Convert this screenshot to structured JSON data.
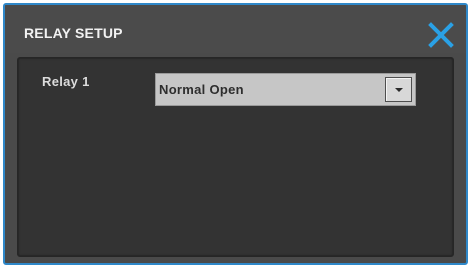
{
  "window": {
    "title": "RELAY SETUP",
    "close_icon": "close-icon"
  },
  "relay": {
    "label": "Relay 1",
    "selected_value": "Normal Open",
    "dropdown_icon": "chevron-down-icon"
  },
  "colors": {
    "accent": "#2f88c9",
    "close_icon": "#2aa1e6",
    "dialog_bg": "#4a4a4a",
    "panel_bg": "#333333",
    "select_bg": "#c6c6c6"
  }
}
